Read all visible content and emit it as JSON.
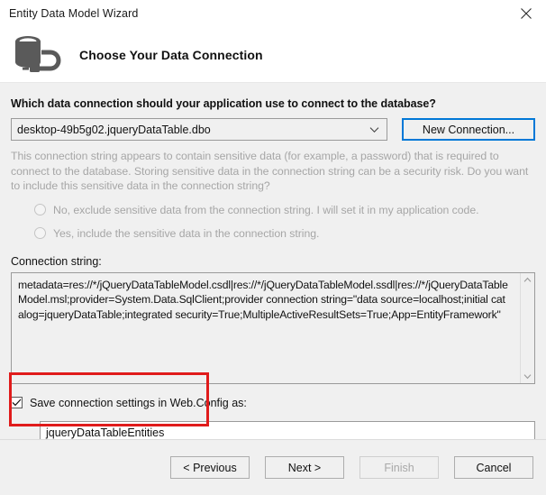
{
  "window": {
    "title": "Entity Data Model Wizard",
    "close_icon": "close-icon"
  },
  "banner": {
    "icon": "database-connection-icon",
    "title": "Choose Your Data Connection"
  },
  "main": {
    "question": "Which data connection should your application use to connect to the database?",
    "connection_dropdown": {
      "value": "desktop-49b5g02.jqueryDataTable.dbo",
      "arrow_icon": "chevron-down-icon"
    },
    "new_connection_button": "New Connection...",
    "sensitive_notice": "This connection string appears to contain sensitive data (for example, a password) that is required to connect to the database. Storing sensitive data in the connection string can be a security risk. Do you want to include this sensitive data in the connection string?",
    "radio_options": [
      {
        "label": "No, exclude sensitive data from the connection string. I will set it in my application code.",
        "selected": false,
        "disabled": true
      },
      {
        "label": "Yes, include the sensitive data in the connection string.",
        "selected": false,
        "disabled": true
      }
    ],
    "connection_string_label": "Connection string:",
    "connection_string_value": "metadata=res://*/jQueryDataTableModel.csdl|res://*/jQueryDataTableModel.ssdl|res://*/jQueryDataTableModel.msl;provider=System.Data.SqlClient;provider connection string=\"data source=localhost;initial catalog=jqueryDataTable;integrated security=True;MultipleActiveResultSets=True;App=EntityFramework\"",
    "scroll_up_icon": "chevron-up-icon",
    "scroll_down_icon": "chevron-down-icon",
    "save_checkbox": {
      "label": "Save connection settings in Web.Config as:",
      "checked": true,
      "check_icon": "checkmark-icon"
    },
    "entity_name_value": "jqueryDataTableEntities"
  },
  "footer": {
    "previous_button": "< Previous",
    "next_button": "Next >",
    "finish_button": "Finish",
    "cancel_button": "Cancel",
    "finish_disabled": true
  },
  "annotations": {
    "accent_color": "#e01b1b",
    "focus_color": "#0078d7"
  }
}
